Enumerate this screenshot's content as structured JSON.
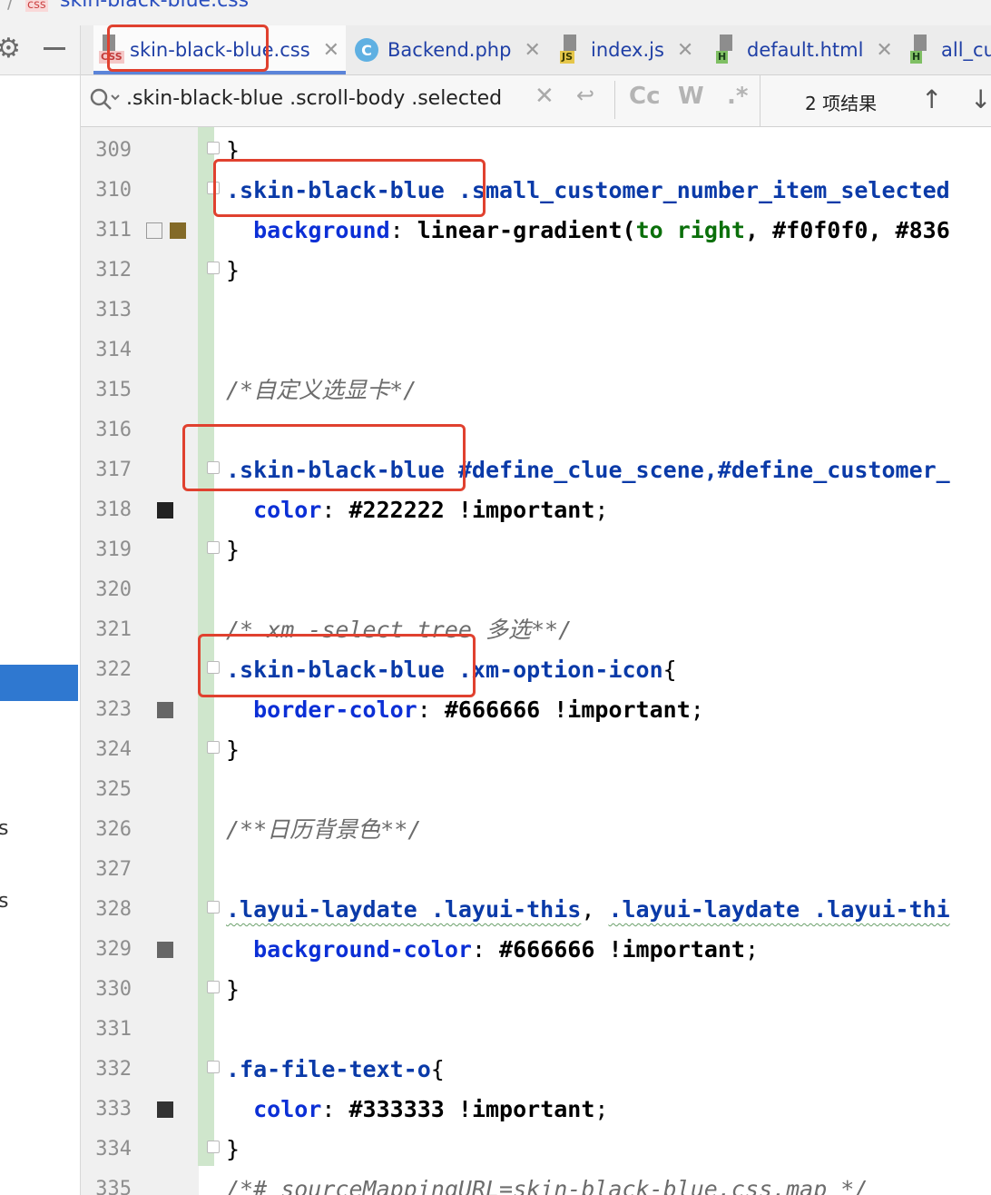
{
  "breadcrumb": {
    "slash": "/",
    "badge": "css",
    "path": "skin-black-blue.css"
  },
  "left_panel": {
    "fragment_1": "s",
    "fragment_2": "s"
  },
  "tabs": [
    {
      "name": "skin-black-blue.css",
      "icon": "css-file-icon",
      "active": true
    },
    {
      "name": "Backend.php",
      "icon": "php-class-icon",
      "active": false
    },
    {
      "name": "index.js",
      "icon": "js-file-icon",
      "active": false
    },
    {
      "name": "default.html",
      "icon": "html-file-icon",
      "active": false
    },
    {
      "name": "all_cu",
      "icon": "html-file-icon",
      "active": false
    }
  ],
  "search": {
    "query": ".skin-black-blue .scroll-body .selected",
    "match_case": "Cc",
    "whole_word": "W",
    "regex": ".*",
    "result_count": "2 项结果"
  },
  "code": {
    "line_numbers": [
      "309",
      "310",
      "311",
      "312",
      "313",
      "314",
      "315",
      "316",
      "317",
      "318",
      "319",
      "320",
      "321",
      "322",
      "323",
      "324",
      "325",
      "326",
      "327",
      "328",
      "329",
      "330",
      "331",
      "332",
      "333",
      "334",
      "335"
    ],
    "l309": "}",
    "l310_sel": ".skin-black-blue",
    "l310_rest": " .small_customer_number_item_selected",
    "l311_prop": "background",
    "l311_fn": "linear-gradient(",
    "l311_kw": "to right",
    "l311_vals": ", #f0f0f0, #836",
    "l312": "}",
    "l315_cmt": "/*自定义选显卡*/",
    "l317_sel": ".skin-black-blue",
    "l317_rest": " #define_clue_scene,#define_customer_",
    "l318_prop": "color",
    "l318_val": "#222222 !important",
    "l319": "}",
    "l321_cmt": "/* xm -select tree 多选**/",
    "l322_sel": ".skin-black-blue",
    "l322_rest": " .xm-option-icon",
    "l322_brace": "{",
    "l323_prop": "border-color",
    "l323_val": "#666666 !important",
    "l324": "}",
    "l326_cmt": "/**日历背景色**/",
    "l328_a": ".layui-laydate",
    "l328_b": " .layui-this",
    "l328_c": ", ",
    "l328_d": ".layui-laydate",
    "l328_e": " .layui-thi",
    "l329_prop": "background-color",
    "l329_val": "#666666 !important",
    "l330": "}",
    "l332_sel": ".fa-file-text-o",
    "l332_brace": "{",
    "l333_prop": "color",
    "l333_val": "#333333 !important",
    "l334": "}",
    "l335_cmt": "/*# sourceMappingURL=skin-black-blue.css.map */"
  },
  "colors": {
    "swatch_311": "#836a28",
    "swatch_318": "#222222",
    "swatch_323": "#666666",
    "swatch_329": "#666666",
    "swatch_333": "#333333",
    "annotation": "#e0412f"
  }
}
